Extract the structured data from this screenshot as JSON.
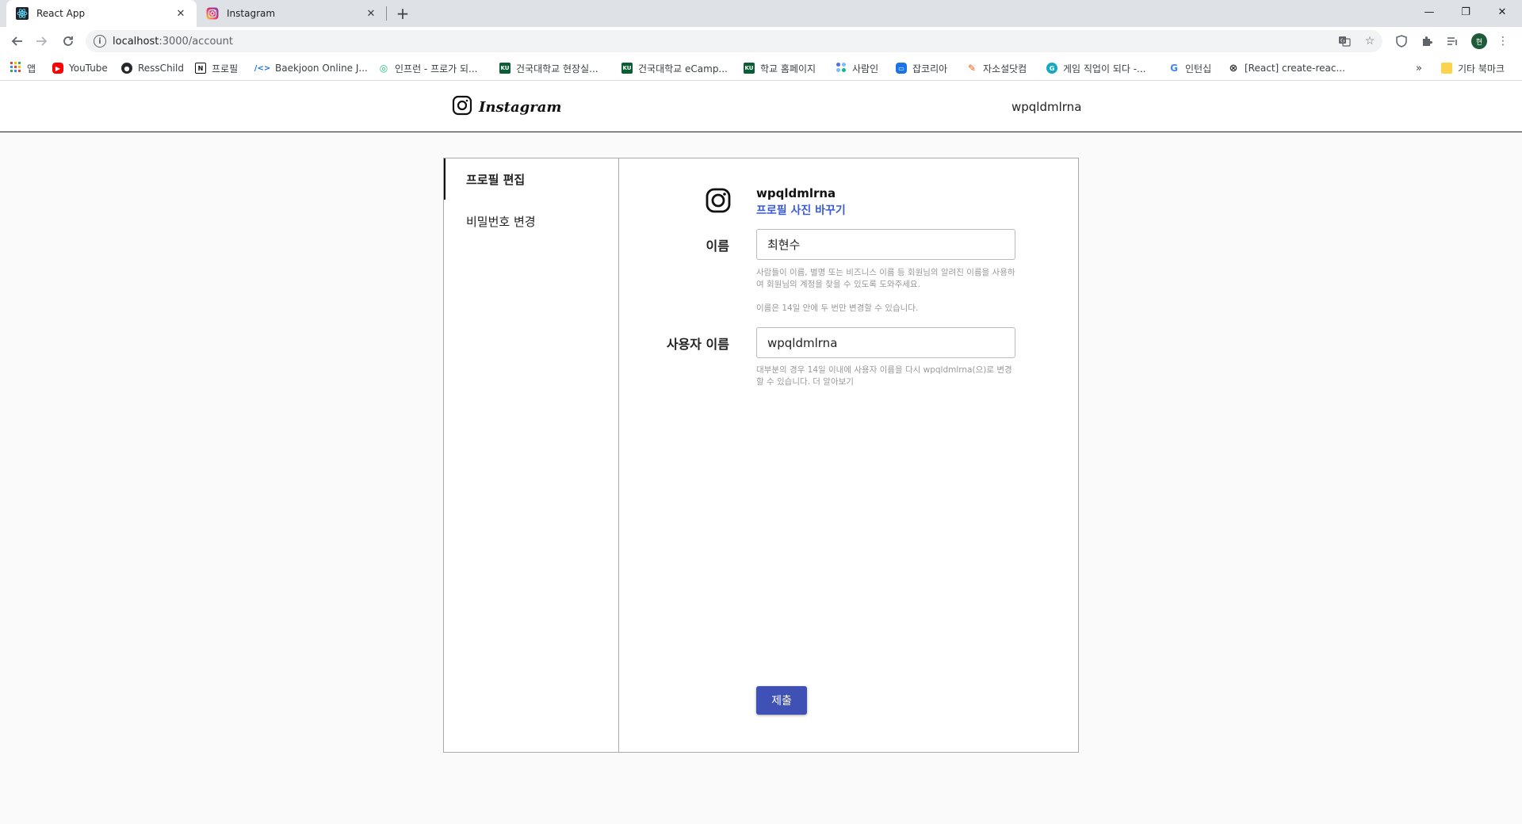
{
  "browser": {
    "tabs": [
      {
        "title": "React App",
        "icon": "react-icon"
      },
      {
        "title": "Instagram",
        "icon": "instagram-icon"
      }
    ],
    "url_host": "localhost",
    "url_path": ":3000/account",
    "profile_initial": "현"
  },
  "bookmarks": {
    "items": [
      {
        "label": "앱",
        "icon": "apps-grid-icon",
        "color": "#ea4335"
      },
      {
        "label": "YouTube",
        "icon": "youtube-icon",
        "color": "#ff0000"
      },
      {
        "label": "RessChild",
        "icon": "github-icon",
        "color": "#24292e"
      },
      {
        "label": "프로필",
        "icon": "notion-icon",
        "color": "#111111"
      },
      {
        "label": "Baekjoon Online J...",
        "icon": "code-icon",
        "color": "#1a73e8"
      },
      {
        "label": "인프런 - 프로가 되...",
        "icon": "inflearn-icon",
        "color": "#1dc078"
      },
      {
        "label": "건국대학교 현장실...",
        "icon": "ku-icon",
        "color": "#0b5d35"
      },
      {
        "label": "건국대학교 eCamp...",
        "icon": "ku-icon",
        "color": "#0b5d35"
      },
      {
        "label": "학교 홈페이지",
        "icon": "ku-icon",
        "color": "#0b5d35"
      },
      {
        "label": "사람인",
        "icon": "saramin-icon",
        "color": "#4c6ef5"
      },
      {
        "label": "잡코리아",
        "icon": "jobkorea-icon",
        "color": "#1a73e8"
      },
      {
        "label": "자소설닷컴",
        "icon": "pen-icon",
        "color": "#e8590c"
      },
      {
        "label": "게임 직업이 되다 -...",
        "icon": "game-icon",
        "color": "#15aabf"
      },
      {
        "label": "인턴십",
        "icon": "google-icon",
        "color": "#4285f4"
      },
      {
        "label": "[React] create-reac...",
        "icon": "velog-icon",
        "color": "#333333"
      }
    ],
    "more": "»",
    "other_bookmarks": "기타 북마크"
  },
  "header": {
    "brand": "Instagram",
    "username": "wpqldmlrna"
  },
  "sidebar": {
    "items": [
      {
        "label": "프로필 편집"
      },
      {
        "label": "비밀번호 변경"
      }
    ]
  },
  "profile": {
    "username": "wpqldmlrna",
    "change_photo": "프로필 사진 바꾸기"
  },
  "form": {
    "name_label": "이름",
    "name_value": "최현수",
    "name_help1": "사람들이 이름, 별명 또는 비즈니스 이름 등 회원님의 알려진 이름을 사용하여 회원님의 계정을 찾을 수 있도록 도와주세요.",
    "name_help2": "이름은 14일 안에 두 번만 변경할 수 있습니다.",
    "username_label": "사용자 이름",
    "username_value": "wpqldmlrna",
    "username_help": "대부분의 경우 14일 이내에 사용자 이름을 다시 wpqldmlrna(으)로 변경할 수 있습니다. 더 알아보기",
    "submit": "제출"
  },
  "colors": {
    "accent": "#3f51b5",
    "link": "#3b5bdb"
  }
}
